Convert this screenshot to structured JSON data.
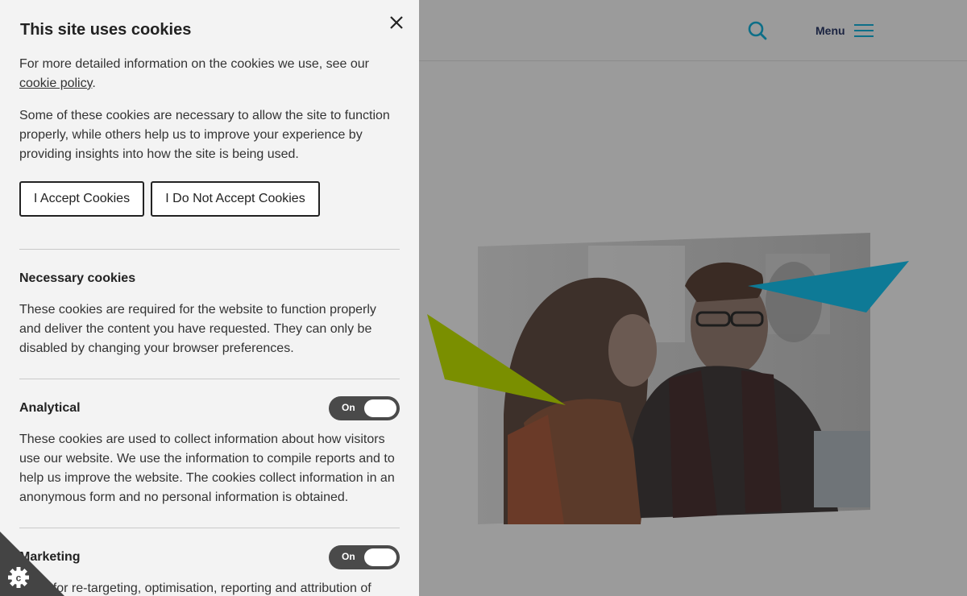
{
  "header": {
    "menu_label": "Menu",
    "search_icon": "search-icon",
    "menu_icon": "hamburger-icon"
  },
  "cookie_panel": {
    "title": "This site uses cookies",
    "intro_text": "For more detailed information on the cookies we use, see our ",
    "policy_link": "cookie policy",
    "intro_end": ".",
    "intro2": "Some of these cookies are necessary to allow the site to function properly, while others help us to improve your experience by providing insights into how the site is being used.",
    "accept_label": "I Accept Cookies",
    "decline_label": "I Do Not Accept Cookies",
    "sections": [
      {
        "title": "Necessary cookies",
        "text": "These cookies are required for the website to function properly and deliver the content you have requested. They can only be disabled by changing your browser preferences."
      },
      {
        "title": "Analytical",
        "toggle": "On",
        "text": "These cookies are used to collect information about how visitors use our website. We use the information to compile reports and to help us improve the website. The cookies collect information in an anonymous form and no personal information is obtained."
      },
      {
        "title": "Marketing",
        "toggle": "On",
        "text": "Used for re-targeting, optimisation, reporting and attribution of"
      }
    ]
  },
  "colors": {
    "panel_bg": "#f3f3f3",
    "overlay_bg": "#9b9b9b",
    "accent_teal": "#0e7a96",
    "accent_green": "#7a8f00",
    "toggle_bg": "#4a4a4a"
  }
}
